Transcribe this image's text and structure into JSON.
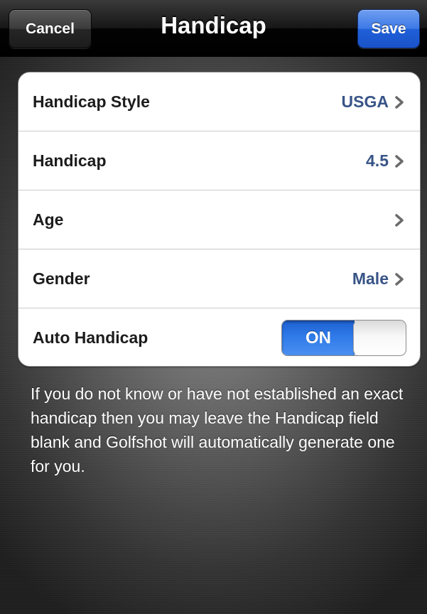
{
  "nav": {
    "title": "Handicap",
    "cancel_label": "Cancel",
    "save_label": "Save"
  },
  "rows": [
    {
      "label": "Handicap Style",
      "value": "USGA",
      "icon": "chevron-right-icon"
    },
    {
      "label": "Handicap",
      "value": "4.5",
      "icon": "chevron-right-icon"
    },
    {
      "label": "Age",
      "value": "",
      "icon": "chevron-right-icon"
    },
    {
      "label": "Gender",
      "value": "Male",
      "icon": "chevron-right-icon"
    }
  ],
  "auto_handicap": {
    "label": "Auto Handicap",
    "toggle_label": "ON",
    "state": true
  },
  "footer": {
    "text": "If you do not know or have not established an exact handicap then you may leave the Handicap field blank and Golfshot will automatically generate one for you."
  },
  "colors": {
    "value_text": "#385487",
    "toggle_on": "#2f7ae9",
    "save_button": "#3c78e6"
  }
}
